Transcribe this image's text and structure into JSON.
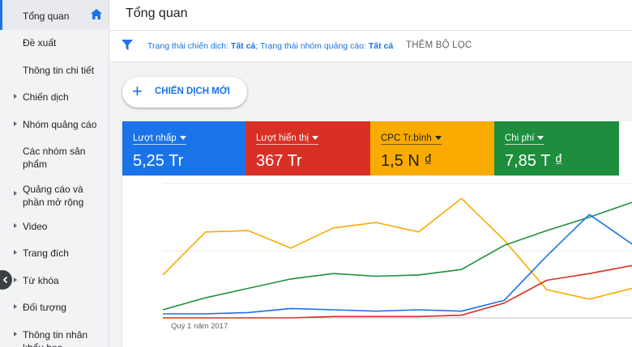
{
  "sidebar": {
    "items": [
      {
        "label": "Tổng quan",
        "caret": false,
        "active": true
      },
      {
        "label": "Đề xuất",
        "caret": false
      },
      {
        "label": "Thông tin chi tiết",
        "caret": false
      },
      {
        "label": "Chiến dịch",
        "caret": true
      },
      {
        "label": "Nhóm quảng cáo",
        "caret": true
      },
      {
        "label": "Các nhóm sản phẩm",
        "caret": false
      },
      {
        "label": "Quảng cáo và phần mở rộng",
        "caret": true
      },
      {
        "label": "Video",
        "caret": true
      },
      {
        "label": "Trang đích",
        "caret": true
      },
      {
        "label": "Từ khóa",
        "caret": true
      },
      {
        "label": "Đối tượng",
        "caret": true
      },
      {
        "label": "Thông tin nhân khẩu học",
        "caret": true
      }
    ]
  },
  "header": {
    "title": "Tổng quan"
  },
  "filter": {
    "campaign_status_label": "Trạng thái chiến dịch: ",
    "campaign_status_value": "Tất cả",
    "separator": "; ",
    "adgroup_status_label": "Trạng thái nhóm quảng cáo: ",
    "adgroup_status_value": "Tất cả",
    "add_filter": "THÊM BỘ LỌC"
  },
  "new_campaign": {
    "plus": "+",
    "label": "CHIẾN DỊCH MỚI"
  },
  "metrics": [
    {
      "name": "Lượt nhấp",
      "value": "5,25 Tr",
      "color": "#1a73e8",
      "text": "#ffffff"
    },
    {
      "name": "Lượt hiển thị",
      "value": "367 Tr",
      "color": "#d93025",
      "text": "#ffffff"
    },
    {
      "name": "CPC Tr.bình",
      "value": "1,5 N ₫",
      "color": "#f9ab00",
      "text": "#202124"
    },
    {
      "name": "Chi phí",
      "value": "7,85 T ₫",
      "color": "#1e8e3e",
      "text": "#ffffff"
    }
  ],
  "chart": {
    "period_label": "Quý 1 năm 2017"
  },
  "chart_data": {
    "type": "line",
    "x": [
      1,
      2,
      3,
      4,
      5,
      6,
      7,
      8,
      9,
      10,
      11,
      12
    ],
    "ylim": [
      0,
      100
    ],
    "grid": true,
    "series": [
      {
        "color": "#f9ab00",
        "values": [
          32,
          64,
          65,
          52,
          67,
          71,
          64,
          89,
          58,
          21,
          14,
          22
        ]
      },
      {
        "color": "#1e8e3e",
        "values": [
          6,
          15,
          22,
          29,
          33,
          31,
          32,
          36,
          54,
          65,
          75,
          86
        ]
      },
      {
        "color": "#1a73e8",
        "values": [
          3,
          3,
          4,
          7,
          6,
          5,
          6,
          5,
          13,
          46,
          77,
          55
        ]
      },
      {
        "color": "#d93025",
        "values": [
          0,
          0,
          0,
          0,
          1,
          1,
          1,
          2,
          11,
          28,
          33,
          39
        ]
      }
    ]
  },
  "icons": {
    "home": "home-icon",
    "filter": "filter-icon",
    "collapse": "chevron-left-icon"
  }
}
